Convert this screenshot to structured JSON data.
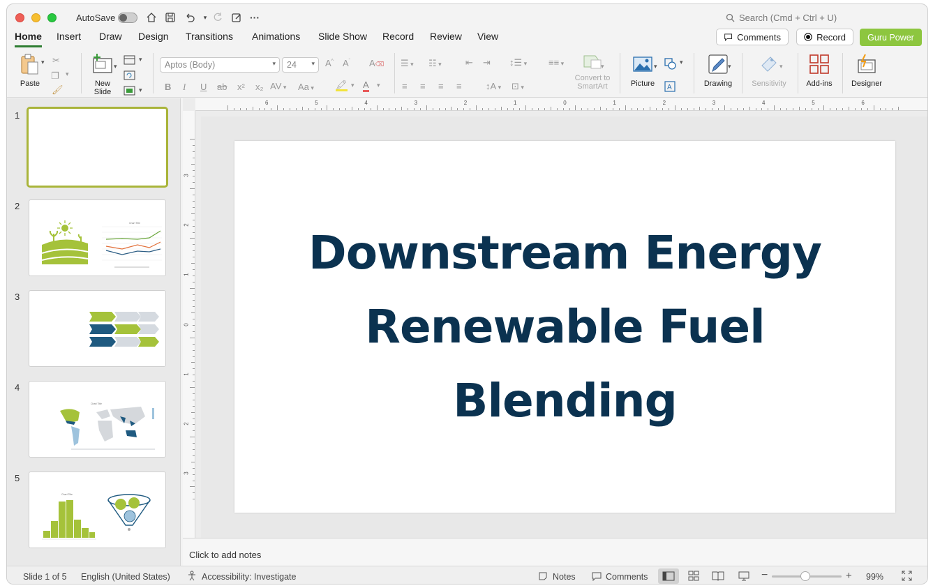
{
  "titlebar": {
    "autosave_label": "AutoSave",
    "search_placeholder": "Search (Cmd + Ctrl + U)"
  },
  "tabs": [
    "Home",
    "Insert",
    "Draw",
    "Design",
    "Transitions",
    "Animations",
    "Slide Show",
    "Record",
    "Review",
    "View"
  ],
  "active_tab": "Home",
  "header_buttons": {
    "comments": "Comments",
    "record": "Record",
    "guru_power": "Guru Power"
  },
  "ribbon": {
    "paste": "Paste",
    "new_slide_line1": "New",
    "new_slide_line2": "Slide",
    "font_name": "Aptos (Body)",
    "font_size": "24",
    "convert_line1": "Convert to",
    "convert_line2": "SmartArt",
    "picture": "Picture",
    "drawing": "Drawing",
    "sensitivity": "Sensitivity",
    "add_ins": "Add-ins",
    "designer": "Designer"
  },
  "thumbnails": [
    {
      "number": "1",
      "selected": true
    },
    {
      "number": "2",
      "selected": false
    },
    {
      "number": "3",
      "selected": false
    },
    {
      "number": "4",
      "selected": false
    },
    {
      "number": "5",
      "selected": false
    }
  ],
  "thumbnail_mini_text": {
    "chart_title": "Chart Title"
  },
  "ruler": {
    "horizontal": [
      "6",
      "5",
      "4",
      "3",
      "2",
      "1",
      "0",
      "1",
      "2",
      "3",
      "4",
      "5",
      "6"
    ],
    "vertical": [
      "3",
      "2",
      "1",
      "0",
      "1",
      "2",
      "3"
    ]
  },
  "slide": {
    "title_line1": "Downstream Energy",
    "title_line2": "Renewable Fuel",
    "title_line3": "Blending",
    "title_color": "#0b3250"
  },
  "notes_placeholder": "Click to add notes",
  "status": {
    "slide_counter": "Slide 1 of 5",
    "language": "English (United States)",
    "accessibility": "Accessibility: Investigate",
    "notes": "Notes",
    "comments": "Comments",
    "zoom": "99%"
  },
  "colors": {
    "accent_green": "#8dc63f",
    "tab_underline": "#2e7d32",
    "thumb_green": "#a5c23a",
    "thumb_navy": "#1f5a80"
  }
}
